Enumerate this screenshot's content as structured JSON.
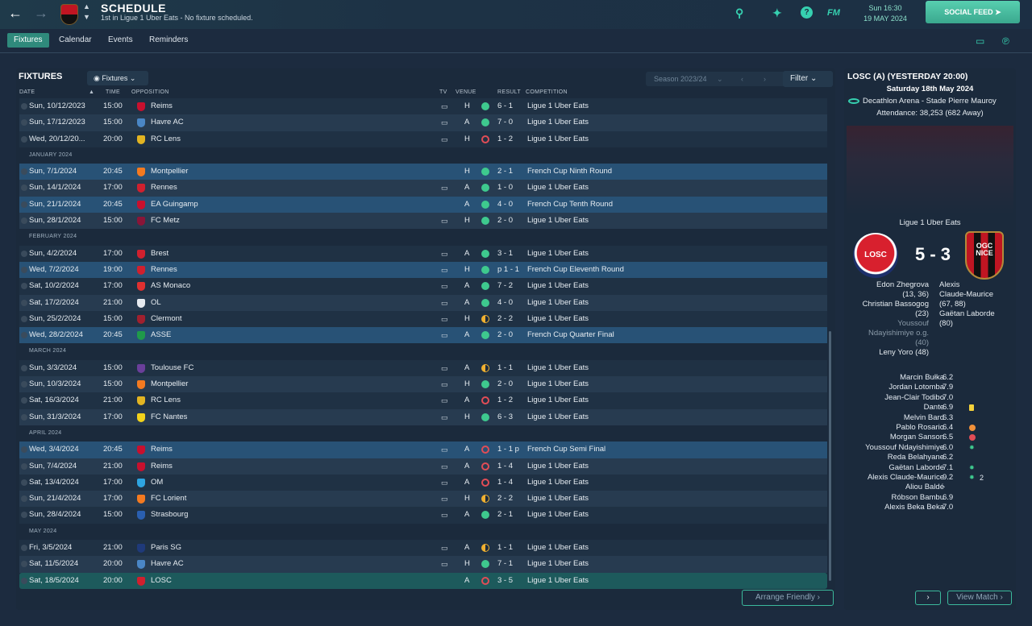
{
  "header": {
    "title": "SCHEDULE",
    "subtitle": "1st in Ligue 1 Uber Eats - No fixture scheduled.",
    "time": "Sun 16:30",
    "date": "19 MAY 2024",
    "social_label": "SOCIAL FEED",
    "fm_label": "FM"
  },
  "tabs": [
    "Fixtures",
    "Calendar",
    "Events",
    "Reminders"
  ],
  "fixtures_panel": {
    "title": "FIXTURES",
    "view_label": "Fixtures",
    "season": "Season 2023/24",
    "filter_label": "Filter",
    "arrange_label": "Arrange Friendly",
    "columns": {
      "date": "DATE",
      "time": "TIME",
      "opposition": "OPPOSITION",
      "tv": "TV",
      "venue": "VENUE",
      "result": "RESULT",
      "competition": "COMPETITION"
    },
    "rows": [
      {
        "kind": "fixture",
        "date": "Sun, 10/12/2023",
        "time": "15:00",
        "opp": "Reims",
        "tv": true,
        "venue": "H",
        "res": "w",
        "score": "6 - 1",
        "comp": "Ligue 1 Uber Eats",
        "badge": "#c8102e"
      },
      {
        "kind": "fixture",
        "date": "Sun, 17/12/2023",
        "time": "15:00",
        "opp": "Havre AC",
        "tv": true,
        "venue": "A",
        "res": "w",
        "score": "7 - 0",
        "comp": "Ligue 1 Uber Eats",
        "badge": "#4a86c5"
      },
      {
        "kind": "fixture",
        "date": "Wed, 20/12/20...",
        "time": "20:00",
        "opp": "RC Lens",
        "tv": true,
        "venue": "H",
        "res": "l",
        "score": "1 - 2",
        "comp": "Ligue 1 Uber Eats",
        "badge": "#e2b422"
      },
      {
        "kind": "month",
        "label": "JANUARY 2024"
      },
      {
        "kind": "fixture",
        "hl": "hl",
        "date": "Sun, 7/1/2024",
        "time": "20:45",
        "opp": "Montpellier",
        "tv": false,
        "venue": "H",
        "res": "w",
        "score": "2 - 1",
        "comp": "French Cup Ninth Round",
        "badge": "#f47a20"
      },
      {
        "kind": "fixture",
        "date": "Sun, 14/1/2024",
        "time": "17:00",
        "opp": "Rennes",
        "tv": true,
        "venue": "A",
        "res": "w",
        "score": "1 - 0",
        "comp": "Ligue 1 Uber Eats",
        "badge": "#d0202e"
      },
      {
        "kind": "fixture",
        "hl": "hl",
        "date": "Sun, 21/1/2024",
        "time": "20:45",
        "opp": "EA Guingamp",
        "tv": false,
        "venue": "A",
        "res": "w",
        "score": "4 - 0",
        "comp": "French Cup Tenth Round",
        "badge": "#c8102e"
      },
      {
        "kind": "fixture",
        "date": "Sun, 28/1/2024",
        "time": "15:00",
        "opp": "FC Metz",
        "tv": true,
        "venue": "H",
        "res": "w",
        "score": "2 - 0",
        "comp": "Ligue 1 Uber Eats",
        "badge": "#8a1538"
      },
      {
        "kind": "month",
        "label": "FEBRUARY 2024"
      },
      {
        "kind": "fixture",
        "date": "Sun, 4/2/2024",
        "time": "17:00",
        "opp": "Brest",
        "tv": true,
        "venue": "A",
        "res": "w",
        "score": "3 - 1",
        "comp": "Ligue 1 Uber Eats",
        "badge": "#d0202e"
      },
      {
        "kind": "fixture",
        "hl": "hl",
        "date": "Wed, 7/2/2024",
        "time": "19:00",
        "opp": "Rennes",
        "tv": true,
        "venue": "H",
        "res": "w",
        "score": "p 1 - 1",
        "comp": "French Cup Eleventh Round",
        "badge": "#d0202e"
      },
      {
        "kind": "fixture",
        "date": "Sat, 10/2/2024",
        "time": "17:00",
        "opp": "AS Monaco",
        "tv": true,
        "venue": "A",
        "res": "w",
        "score": "7 - 2",
        "comp": "Ligue 1 Uber Eats",
        "badge": "#e03030"
      },
      {
        "kind": "fixture",
        "date": "Sat, 17/2/2024",
        "time": "21:00",
        "opp": "OL",
        "tv": true,
        "venue": "A",
        "res": "w",
        "score": "4 - 0",
        "comp": "Ligue 1 Uber Eats",
        "badge": "#e6eaf0"
      },
      {
        "kind": "fixture",
        "date": "Sun, 25/2/2024",
        "time": "15:00",
        "opp": "Clermont",
        "tv": true,
        "venue": "H",
        "res": "d",
        "score": "2 - 2",
        "comp": "Ligue 1 Uber Eats",
        "badge": "#a0202e"
      },
      {
        "kind": "fixture",
        "hl": "hl",
        "date": "Wed, 28/2/2024",
        "time": "20:45",
        "opp": "ASSE",
        "tv": true,
        "venue": "A",
        "res": "w",
        "score": "2 - 0",
        "comp": "French Cup Quarter Final",
        "badge": "#1f9a4a"
      },
      {
        "kind": "month",
        "label": "MARCH 2024"
      },
      {
        "kind": "fixture",
        "date": "Sun, 3/3/2024",
        "time": "15:00",
        "opp": "Toulouse FC",
        "tv": true,
        "venue": "A",
        "res": "d",
        "score": "1 - 1",
        "comp": "Ligue 1 Uber Eats",
        "badge": "#6a3f9a"
      },
      {
        "kind": "fixture",
        "date": "Sun, 10/3/2024",
        "time": "15:00",
        "opp": "Montpellier",
        "tv": true,
        "venue": "H",
        "res": "w",
        "score": "2 - 0",
        "comp": "Ligue 1 Uber Eats",
        "badge": "#f47a20"
      },
      {
        "kind": "fixture",
        "date": "Sat, 16/3/2024",
        "time": "21:00",
        "opp": "RC Lens",
        "tv": true,
        "venue": "A",
        "res": "l",
        "score": "1 - 2",
        "comp": "Ligue 1 Uber Eats",
        "badge": "#e2b422"
      },
      {
        "kind": "fixture",
        "date": "Sun, 31/3/2024",
        "time": "17:00",
        "opp": "FC Nantes",
        "tv": true,
        "venue": "H",
        "res": "w",
        "score": "6 - 3",
        "comp": "Ligue 1 Uber Eats",
        "badge": "#f2d21b"
      },
      {
        "kind": "month",
        "label": "APRIL 2024"
      },
      {
        "kind": "fixture",
        "hl": "hl",
        "date": "Wed, 3/4/2024",
        "time": "20:45",
        "opp": "Reims",
        "tv": true,
        "venue": "A",
        "res": "l",
        "score": "1 - 1 p",
        "comp": "French Cup Semi Final",
        "badge": "#c8102e"
      },
      {
        "kind": "fixture",
        "date": "Sun, 7/4/2024",
        "time": "21:00",
        "opp": "Reims",
        "tv": true,
        "venue": "A",
        "res": "l",
        "score": "1 - 4",
        "comp": "Ligue 1 Uber Eats",
        "badge": "#c8102e"
      },
      {
        "kind": "fixture",
        "date": "Sat, 13/4/2024",
        "time": "17:00",
        "opp": "OM",
        "tv": true,
        "venue": "A",
        "res": "l",
        "score": "1 - 4",
        "comp": "Ligue 1 Uber Eats",
        "badge": "#2ea4e0"
      },
      {
        "kind": "fixture",
        "date": "Sun, 21/4/2024",
        "time": "17:00",
        "opp": "FC Lorient",
        "tv": true,
        "venue": "H",
        "res": "d",
        "score": "2 - 2",
        "comp": "Ligue 1 Uber Eats",
        "badge": "#f47a20"
      },
      {
        "kind": "fixture",
        "date": "Sun, 28/4/2024",
        "time": "15:00",
        "opp": "Strasbourg",
        "tv": true,
        "venue": "A",
        "res": "w",
        "score": "2 - 1",
        "comp": "Ligue 1 Uber Eats",
        "badge": "#2a5fb0"
      },
      {
        "kind": "month",
        "label": "MAY 2024"
      },
      {
        "kind": "fixture",
        "date": "Fri, 3/5/2024",
        "time": "21:00",
        "opp": "Paris SG",
        "tv": true,
        "venue": "A",
        "res": "d",
        "score": "1 - 1",
        "comp": "Ligue 1 Uber Eats",
        "badge": "#1f3a7a"
      },
      {
        "kind": "fixture",
        "date": "Sat, 11/5/2024",
        "time": "20:00",
        "opp": "Havre AC",
        "tv": true,
        "venue": "H",
        "res": "w",
        "score": "7 - 1",
        "comp": "Ligue 1 Uber Eats",
        "badge": "#4a86c5"
      },
      {
        "kind": "fixture",
        "hl": "hl2",
        "date": "Sat, 18/5/2024",
        "time": "20:00",
        "opp": "LOSC",
        "tv": false,
        "venue": "A",
        "res": "l",
        "score": "3 - 5",
        "comp": "Ligue 1 Uber Eats",
        "badge": "#d0202e"
      }
    ]
  },
  "match_panel": {
    "title": "LOSC (A) (YESTERDAY 20:00)",
    "date": "Saturday 18th May 2024",
    "stadium": "Decathlon Arena - Stade Pierre Mauroy",
    "attendance": "Attendance: 38,253 (682 Away)",
    "competition": "Ligue 1 Uber Eats",
    "home_crest_text": "LOSC",
    "away_crest_text": "OGC NICE",
    "score": "5 - 3",
    "home_scorers": [
      {
        "text": "Edon Zhegrova",
        "og": false
      },
      {
        "text": "(13, 36)",
        "og": false
      },
      {
        "text": "Christian Bassogog",
        "og": false
      },
      {
        "text": "(23)",
        "og": false
      },
      {
        "text": "Youssouf",
        "og": true
      },
      {
        "text": "Ndayishimiye o.g.",
        "og": true
      },
      {
        "text": "(40)",
        "og": true
      },
      {
        "text": "Leny Yoro (48)",
        "og": false
      }
    ],
    "away_scorers": [
      "Alexis",
      "Claude-Maurice",
      "(67, 88)",
      "Gaëtan Laborde",
      "(80)"
    ],
    "ratings": [
      {
        "name": "Marcin Bułka",
        "rating": "6.2",
        "icon": "",
        "extra": ""
      },
      {
        "name": "Jordan Lotomba",
        "rating": "7.9",
        "icon": "",
        "extra": ""
      },
      {
        "name": "Jean-Clair Todibo",
        "rating": "7.0",
        "icon": "",
        "extra": ""
      },
      {
        "name": "Dante",
        "rating": "6.9",
        "icon": "yellow-card",
        "extra": ""
      },
      {
        "name": "Melvin Bard",
        "rating": "6.3",
        "icon": "",
        "extra": ""
      },
      {
        "name": "Pablo Rosario",
        "rating": "6.4",
        "icon": "sub-on",
        "extra": ""
      },
      {
        "name": "Morgan Sanson",
        "rating": "6.5",
        "icon": "sub-off",
        "extra": ""
      },
      {
        "name": "Youssouf Ndayishimiye",
        "rating": "6.0",
        "icon": "assist",
        "extra": ""
      },
      {
        "name": "Reda Belahyane",
        "rating": "6.2",
        "icon": "",
        "extra": ""
      },
      {
        "name": "Gaëtan Laborde",
        "rating": "7.1",
        "icon": "assist",
        "extra": ""
      },
      {
        "name": "Alexis Claude-Maurice",
        "rating": "9.2",
        "icon": "assist",
        "extra": "2"
      },
      {
        "name": "Aliou Baldé",
        "rating": "-",
        "icon": "",
        "extra": ""
      },
      {
        "name": "Róbson Bambu",
        "rating": "6.9",
        "icon": "",
        "extra": ""
      },
      {
        "name": "Alexis Beka Beka",
        "rating": "7.0",
        "icon": "",
        "extra": ""
      }
    ],
    "next_label": "›",
    "view_match_label": "View Match"
  }
}
